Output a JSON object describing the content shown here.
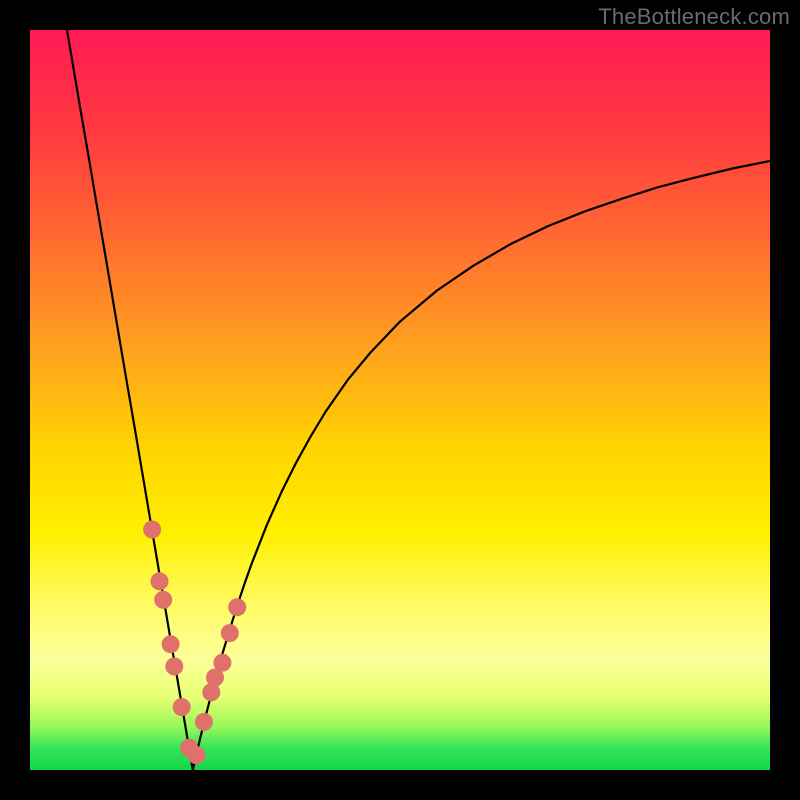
{
  "watermark": "TheBottleneck.com",
  "chart_data": {
    "type": "line",
    "title": "",
    "xlabel": "",
    "ylabel": "",
    "xlim": [
      0,
      100
    ],
    "ylim": [
      0,
      100
    ],
    "grid": false,
    "minimum_x": 22,
    "series": [
      {
        "name": "curve",
        "color": "#000000",
        "x": [
          5,
          6,
          7,
          8,
          9,
          10,
          11,
          12,
          13,
          14,
          15,
          16,
          17,
          18,
          19,
          20,
          21,
          22,
          23,
          24,
          25,
          26,
          27,
          28,
          29,
          30,
          32,
          34,
          36,
          38,
          40,
          43,
          46,
          50,
          55,
          60,
          65,
          70,
          75,
          80,
          85,
          90,
          95,
          100
        ],
        "y": [
          100,
          94.1,
          88.2,
          82.4,
          76.5,
          70.6,
          64.7,
          58.8,
          52.9,
          47.1,
          41.2,
          35.3,
          29.4,
          23.5,
          17.6,
          11.8,
          5.9,
          0,
          4.3,
          8.3,
          12.1,
          15.7,
          19.0,
          22.2,
          25.2,
          28.0,
          33.1,
          37.6,
          41.6,
          45.2,
          48.5,
          52.8,
          56.4,
          60.6,
          64.8,
          68.2,
          71.1,
          73.5,
          75.5,
          77.2,
          78.8,
          80.1,
          81.3,
          82.3
        ]
      }
    ],
    "markers": {
      "name": "dots",
      "color": "#e0706a",
      "radius_px": 9,
      "x": [
        16.5,
        17.5,
        18.0,
        19.0,
        19.5,
        20.5,
        21.5,
        22.5,
        23.5,
        24.5,
        25.0,
        26.0,
        27.0,
        28.0
      ],
      "y": [
        32.5,
        25.5,
        23.0,
        17.0,
        14.0,
        8.5,
        3.0,
        2.0,
        6.5,
        10.5,
        12.5,
        14.5,
        18.5,
        22.0
      ]
    }
  }
}
